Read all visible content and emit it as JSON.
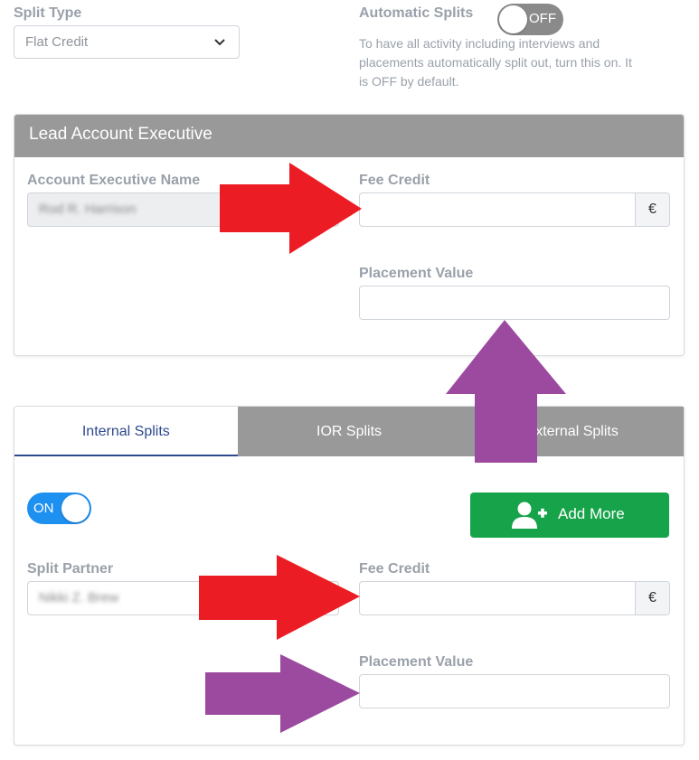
{
  "split_type": {
    "label": "Split Type",
    "value": "Flat Credit"
  },
  "automatic_splits": {
    "label": "Automatic Splits",
    "toggle_text": "OFF",
    "description_lines": [
      "To have all activity including interviews and",
      "placements automatically split out, turn this on. It",
      "is OFF by default."
    ]
  },
  "lead_panel": {
    "title": "Lead Account Executive",
    "ae_name_label": "Account Executive Name",
    "ae_name_value": "Rod R. Harrison",
    "fee_credit_label": "Fee Credit",
    "currency": "€",
    "placement_value_label": "Placement Value"
  },
  "splits_panel": {
    "tabs": [
      "Internal Splits",
      "IOR Splits",
      "External Splits"
    ],
    "toggle_text": "ON",
    "add_more_label": "Add More",
    "split_partner_label": "Split Partner",
    "split_partner_value": "Nikki Z. Brew",
    "fee_credit_label": "Fee Credit",
    "currency": "€",
    "placement_value_label": "Placement Value"
  },
  "colors": {
    "header_gray": "#999999",
    "toggle_on": "#1e90f0",
    "add_button": "#16a34a",
    "tab_active": "#2e4a8e",
    "arrow_red": "#ec1c24",
    "arrow_purple": "#9c4aa0"
  }
}
